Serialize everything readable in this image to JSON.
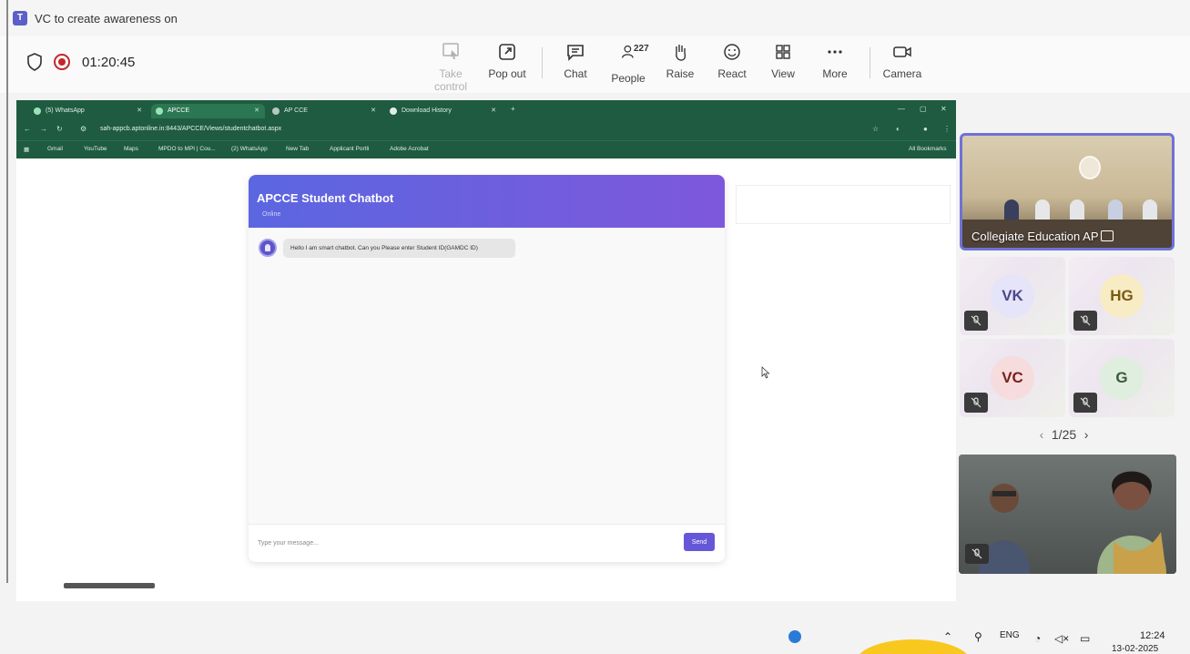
{
  "meeting": {
    "title": "VC to create awareness on",
    "timer": "01:20:45"
  },
  "controls": {
    "take_control": "Take control",
    "pop_out": "Pop out",
    "chat": "Chat",
    "people": "People",
    "people_count": "227",
    "raise": "Raise",
    "react": "React",
    "view": "View",
    "more": "More",
    "camera": "Camera"
  },
  "shared_screen": {
    "tabs": [
      {
        "label": "(5) WhatsApp"
      },
      {
        "label": "APCCE"
      },
      {
        "label": "AP CCE"
      },
      {
        "label": "Download History"
      }
    ],
    "url": "sah-appcb.aptonline.in:8443/APCCE/Views/studentchatbot.aspx",
    "bookmarks": [
      "Gmail",
      "YouTube",
      "Maps",
      "MPDO to MPI | Cou...",
      "(2) WhatsApp",
      "New Tab",
      "Applicant Portli",
      "Adobe Acrobat",
      "All Bookmarks"
    ],
    "chatbot": {
      "title": "APCCE Student Chatbot",
      "status": "Online",
      "bot_message": "Hello I am smart chatbot. Can you Please enter Student ID(GAMDC ID)",
      "input_placeholder": "Type your message...",
      "send_label": "Send"
    }
  },
  "participants": {
    "main_video_name": "Collegiate Education AP",
    "tiles": [
      {
        "initials": "VK",
        "bg": "#e6e4f8",
        "fg": "#4a4a8a"
      },
      {
        "initials": "HG",
        "bg": "#f8ecc4",
        "fg": "#7a5a14"
      },
      {
        "initials": "VC",
        "bg": "#f6dcdc",
        "fg": "#7a1f1f"
      },
      {
        "initials": "G",
        "bg": "#dfeede",
        "fg": "#3a5a3a"
      }
    ],
    "pager": "1/25"
  },
  "taskbar": {
    "language": "ENG",
    "time": "12:24",
    "date": "13-02-2025"
  }
}
